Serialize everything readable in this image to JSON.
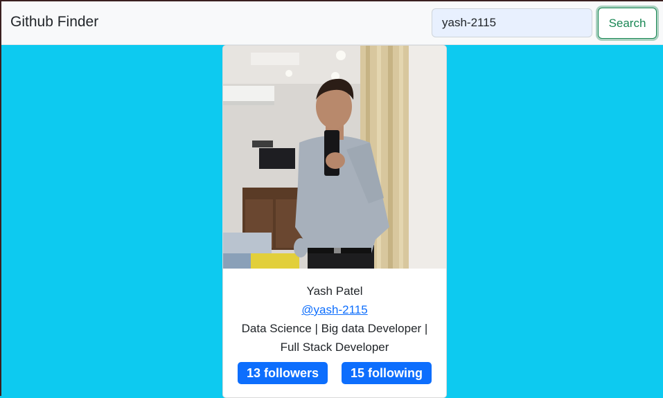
{
  "navbar": {
    "brand": "Github Finder",
    "search_value": "yash-2115",
    "search_button_label": "Search"
  },
  "profile": {
    "name": "Yash Patel",
    "login": "@yash-2115",
    "bio": "Data Science | Big data Developer | Full Stack Developer",
    "followers_label": "13 followers",
    "following_label": "15 following"
  },
  "colors": {
    "page_background": "#0dcaf0",
    "badge": "#0d6efd",
    "search_button": "#198754"
  }
}
